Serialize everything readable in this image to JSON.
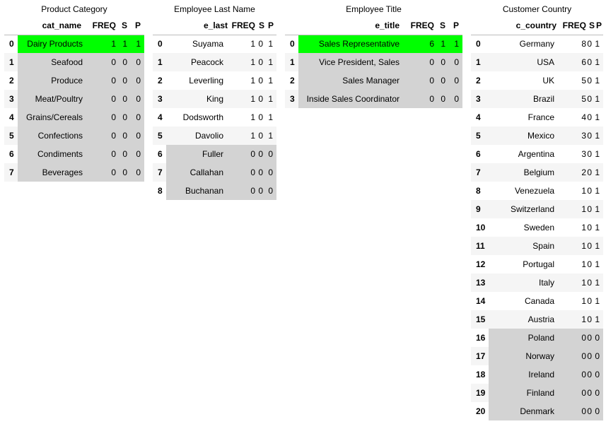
{
  "tables": [
    {
      "title": "Product Category",
      "columns": [
        "cat_name",
        "FREQ",
        "S",
        "P"
      ],
      "rows": [
        {
          "idx": "0",
          "name": "Dairy Products",
          "freq": "1",
          "s": "1",
          "p": "1",
          "hl": "green"
        },
        {
          "idx": "1",
          "name": "Seafood",
          "freq": "0",
          "s": "0",
          "p": "0",
          "hl": "gray"
        },
        {
          "idx": "2",
          "name": "Produce",
          "freq": "0",
          "s": "0",
          "p": "0",
          "hl": "gray"
        },
        {
          "idx": "3",
          "name": "Meat/Poultry",
          "freq": "0",
          "s": "0",
          "p": "0",
          "hl": "gray"
        },
        {
          "idx": "4",
          "name": "Grains/Cereals",
          "freq": "0",
          "s": "0",
          "p": "0",
          "hl": "gray"
        },
        {
          "idx": "5",
          "name": "Confections",
          "freq": "0",
          "s": "0",
          "p": "0",
          "hl": "gray"
        },
        {
          "idx": "6",
          "name": "Condiments",
          "freq": "0",
          "s": "0",
          "p": "0",
          "hl": "gray"
        },
        {
          "idx": "7",
          "name": "Beverages",
          "freq": "0",
          "s": "0",
          "p": "0",
          "hl": "gray"
        }
      ]
    },
    {
      "title": "Employee Last Name",
      "columns": [
        "e_last",
        "FREQ",
        "S",
        "P"
      ],
      "rows": [
        {
          "idx": "0",
          "name": "Suyama",
          "freq": "1",
          "s": "0",
          "p": "1",
          "hl": "none"
        },
        {
          "idx": "1",
          "name": "Peacock",
          "freq": "1",
          "s": "0",
          "p": "1",
          "hl": "none"
        },
        {
          "idx": "2",
          "name": "Leverling",
          "freq": "1",
          "s": "0",
          "p": "1",
          "hl": "none"
        },
        {
          "idx": "3",
          "name": "King",
          "freq": "1",
          "s": "0",
          "p": "1",
          "hl": "none"
        },
        {
          "idx": "4",
          "name": "Dodsworth",
          "freq": "1",
          "s": "0",
          "p": "1",
          "hl": "none"
        },
        {
          "idx": "5",
          "name": "Davolio",
          "freq": "1",
          "s": "0",
          "p": "1",
          "hl": "none"
        },
        {
          "idx": "6",
          "name": "Fuller",
          "freq": "0",
          "s": "0",
          "p": "0",
          "hl": "gray"
        },
        {
          "idx": "7",
          "name": "Callahan",
          "freq": "0",
          "s": "0",
          "p": "0",
          "hl": "gray"
        },
        {
          "idx": "8",
          "name": "Buchanan",
          "freq": "0",
          "s": "0",
          "p": "0",
          "hl": "gray"
        }
      ]
    },
    {
      "title": "Employee Title",
      "columns": [
        "e_title",
        "FREQ",
        "S",
        "P"
      ],
      "rows": [
        {
          "idx": "0",
          "name": "Sales Representative",
          "freq": "6",
          "s": "1",
          "p": "1",
          "hl": "green"
        },
        {
          "idx": "1",
          "name": "Vice President, Sales",
          "freq": "0",
          "s": "0",
          "p": "0",
          "hl": "gray"
        },
        {
          "idx": "2",
          "name": "Sales Manager",
          "freq": "0",
          "s": "0",
          "p": "0",
          "hl": "gray"
        },
        {
          "idx": "3",
          "name": "Inside Sales Coordinator",
          "freq": "0",
          "s": "0",
          "p": "0",
          "hl": "gray"
        }
      ]
    },
    {
      "title": "Customer Country",
      "columns": [
        "c_country",
        "FREQ",
        "S",
        "P"
      ],
      "rows": [
        {
          "idx": "0",
          "name": "Germany",
          "freq": "8",
          "s": "0",
          "p": "1",
          "hl": "none"
        },
        {
          "idx": "1",
          "name": "USA",
          "freq": "6",
          "s": "0",
          "p": "1",
          "hl": "none"
        },
        {
          "idx": "2",
          "name": "UK",
          "freq": "5",
          "s": "0",
          "p": "1",
          "hl": "none"
        },
        {
          "idx": "3",
          "name": "Brazil",
          "freq": "5",
          "s": "0",
          "p": "1",
          "hl": "none"
        },
        {
          "idx": "4",
          "name": "France",
          "freq": "4",
          "s": "0",
          "p": "1",
          "hl": "none"
        },
        {
          "idx": "5",
          "name": "Mexico",
          "freq": "3",
          "s": "0",
          "p": "1",
          "hl": "none"
        },
        {
          "idx": "6",
          "name": "Argentina",
          "freq": "3",
          "s": "0",
          "p": "1",
          "hl": "none"
        },
        {
          "idx": "7",
          "name": "Belgium",
          "freq": "2",
          "s": "0",
          "p": "1",
          "hl": "none"
        },
        {
          "idx": "8",
          "name": "Venezuela",
          "freq": "1",
          "s": "0",
          "p": "1",
          "hl": "none"
        },
        {
          "idx": "9",
          "name": "Switzerland",
          "freq": "1",
          "s": "0",
          "p": "1",
          "hl": "none"
        },
        {
          "idx": "10",
          "name": "Sweden",
          "freq": "1",
          "s": "0",
          "p": "1",
          "hl": "none"
        },
        {
          "idx": "11",
          "name": "Spain",
          "freq": "1",
          "s": "0",
          "p": "1",
          "hl": "none"
        },
        {
          "idx": "12",
          "name": "Portugal",
          "freq": "1",
          "s": "0",
          "p": "1",
          "hl": "none"
        },
        {
          "idx": "13",
          "name": "Italy",
          "freq": "1",
          "s": "0",
          "p": "1",
          "hl": "none"
        },
        {
          "idx": "14",
          "name": "Canada",
          "freq": "1",
          "s": "0",
          "p": "1",
          "hl": "none"
        },
        {
          "idx": "15",
          "name": "Austria",
          "freq": "1",
          "s": "0",
          "p": "1",
          "hl": "none"
        },
        {
          "idx": "16",
          "name": "Poland",
          "freq": "0",
          "s": "0",
          "p": "0",
          "hl": "gray"
        },
        {
          "idx": "17",
          "name": "Norway",
          "freq": "0",
          "s": "0",
          "p": "0",
          "hl": "gray"
        },
        {
          "idx": "18",
          "name": "Ireland",
          "freq": "0",
          "s": "0",
          "p": "0",
          "hl": "gray"
        },
        {
          "idx": "19",
          "name": "Finland",
          "freq": "0",
          "s": "0",
          "p": "0",
          "hl": "gray"
        },
        {
          "idx": "20",
          "name": "Denmark",
          "freq": "0",
          "s": "0",
          "p": "0",
          "hl": "gray"
        }
      ]
    }
  ],
  "colors": {
    "highlight_green": "#00ff00",
    "highlight_gray": "#d3d3d3",
    "stripe": "#f5f5f5"
  }
}
